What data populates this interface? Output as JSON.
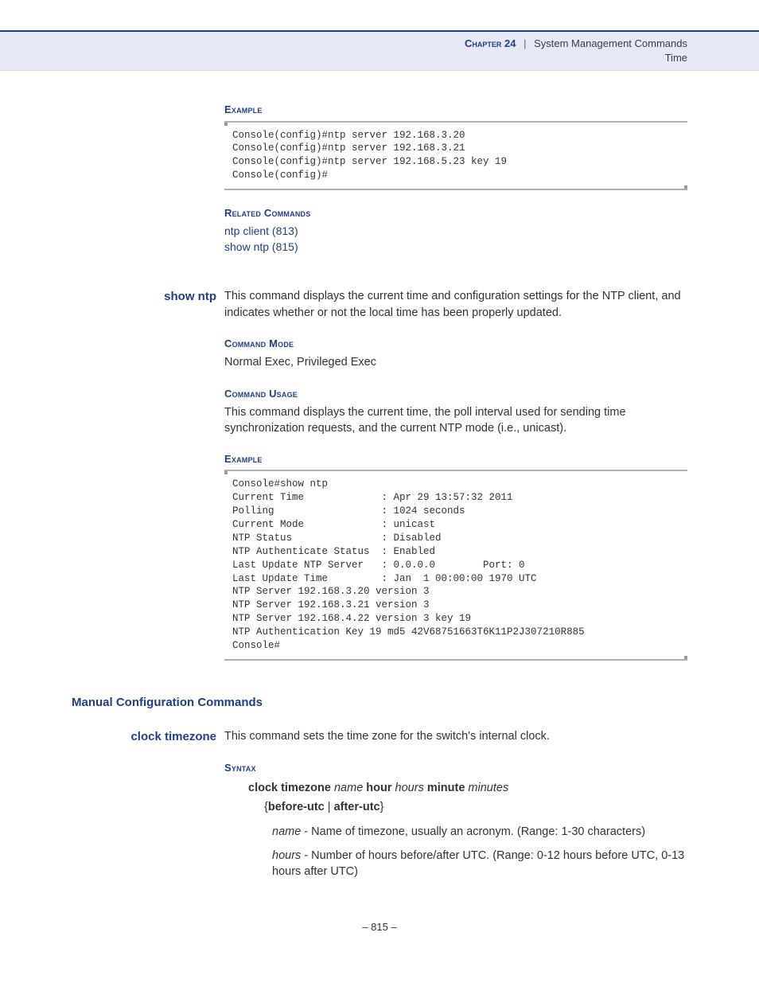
{
  "header": {
    "chapter_label": "Chapter 24",
    "separator": "|",
    "chapter_title": "System Management Commands",
    "subtitle": "Time"
  },
  "section_example1": {
    "heading": "Example",
    "code": "Console(config)#ntp server 192.168.3.20\nConsole(config)#ntp server 192.168.3.21\nConsole(config)#ntp server 192.168.5.23 key 19\nConsole(config)#"
  },
  "related": {
    "heading": "Related Commands",
    "links": [
      "ntp client (813)",
      "show ntp (815)"
    ]
  },
  "show_ntp": {
    "name": "show ntp",
    "desc": "This command displays the current time and configuration settings for the NTP client, and indicates whether or not the local time has been properly updated.",
    "mode_heading": "Command Mode",
    "mode_text": "Normal Exec, Privileged Exec",
    "usage_heading": "Command Usage",
    "usage_text": "This command displays the current time, the poll interval used for sending time synchronization requests, and the current NTP mode (i.e., unicast).",
    "example_heading": "Example",
    "example_code": "Console#show ntp\nCurrent Time             : Apr 29 13:57:32 2011\nPolling                  : 1024 seconds\nCurrent Mode             : unicast\nNTP Status               : Disabled\nNTP Authenticate Status  : Enabled\nLast Update NTP Server   : 0.0.0.0        Port: 0\nLast Update Time         : Jan  1 00:00:00 1970 UTC\nNTP Server 192.168.3.20 version 3\nNTP Server 192.168.3.21 version 3\nNTP Server 192.168.4.22 version 3 key 19\nNTP Authentication Key 19 md5 42V68751663T6K11P2J307210R885\nConsole#"
  },
  "manual_section": {
    "title": "Manual Configuration Commands"
  },
  "clock_tz": {
    "name": "clock timezone",
    "desc": "This command sets the time zone for the switch's internal clock.",
    "syntax_heading": "Syntax",
    "syntax": {
      "kw1": "clock timezone",
      "p1": "name",
      "kw2": "hour",
      "p2": "hours",
      "kw3": "minute",
      "p3": "minutes",
      "brace_open": "{",
      "opt1": "before-utc",
      "pipe": " | ",
      "opt2": "after-utc",
      "brace_close": "}"
    },
    "params": [
      {
        "name": "name",
        "text": " - Name of timezone, usually an acronym. (Range: 1-30 characters)"
      },
      {
        "name": "hours",
        "text": " - Number of hours before/after UTC. (Range: 0-12 hours before UTC, 0-13 hours after UTC)"
      }
    ]
  },
  "footer": {
    "page": "– 815 –"
  }
}
